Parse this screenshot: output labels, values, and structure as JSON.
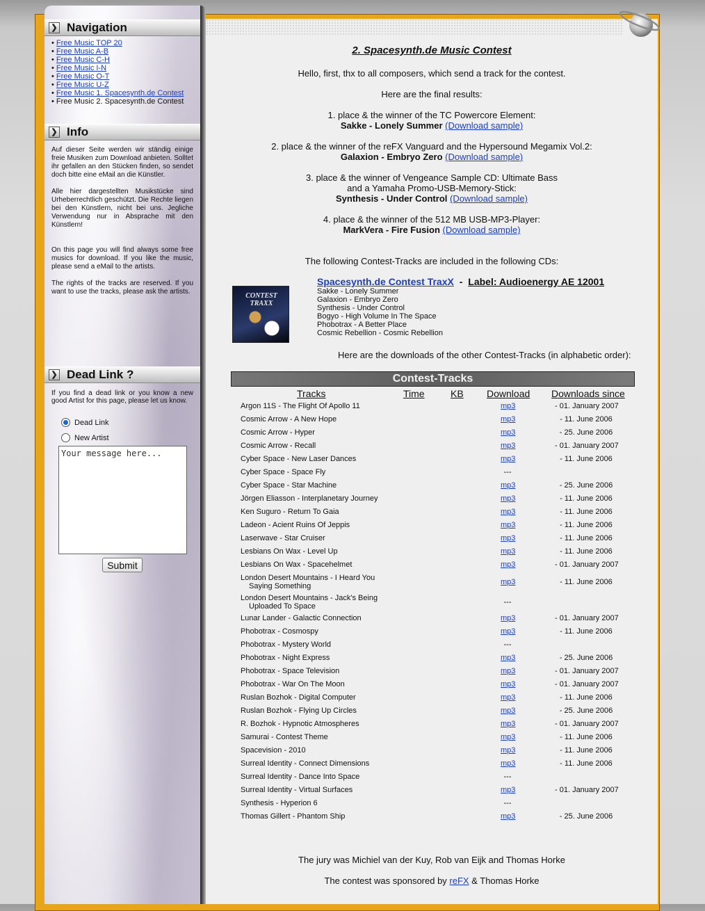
{
  "navigation": {
    "title": "Navigation",
    "items": [
      {
        "label": "Free Music TOP 20",
        "link": true
      },
      {
        "label": "Free Music A-B",
        "link": true
      },
      {
        "label": "Free Music C-H",
        "link": true
      },
      {
        "label": "Free Music I-N",
        "link": true
      },
      {
        "label": "Free Music O-T",
        "link": true
      },
      {
        "label": "Free Music U-Z",
        "link": true
      },
      {
        "label": "Free Music 1. Spacesynth.de Contest",
        "link": true
      },
      {
        "label": "Free Music 2. Spacesynth.de Contest",
        "link": false
      }
    ]
  },
  "info": {
    "title": "Info",
    "p1": "Auf dieser Seite werden wir ständig einige freie Musiken zum Download anbieten. Solltet ihr gefallen an den Stücken finden, so sendet doch bitte eine eMail an die Künstler.",
    "p2": "Alle hier dargestellten Musikstücke sind Urheberrechtlich geschützt. Die Rechte liegen bei den Künstlern, nicht bei uns. Jegliche Verwendung nur in Absprache mit den Künstlern!",
    "p3": "On this page you will find always some free musics for download. If you like the music, please send a eMail to the artists.",
    "p4": "The rights of the tracks are reserved. If you want to use the tracks, please ask the artists."
  },
  "dead_link": {
    "title": "Dead Link ?",
    "text": "If you find a dead link or you know a new good Artist for this page, please let us know.",
    "option_dead": "Dead Link",
    "option_artist": "New Artist",
    "selected": "Dead Link",
    "message_placeholder": "Your message here...",
    "submit_label": "Submit"
  },
  "content": {
    "title": "2. Spacesynth.de Music Contest",
    "intro": "Hello, first, thx to all composers, which send a track for the contest.",
    "results_intro": "Here are the final results:",
    "download_sample": "(Download sample)",
    "winners": [
      {
        "line1": "1. place & the winner of the TC Powercore Element:",
        "line2": "",
        "artist": "Sakke",
        "track": "Lonely Summer"
      },
      {
        "line1": "2. place & the winner of the reFX Vanguard and the Hypersound Megamix Vol.2:",
        "line2": "",
        "artist": "Galaxion",
        "track": "Embryo Zero"
      },
      {
        "line1": "3. place & the winner of Vengeance Sample CD: Ultimate Bass",
        "line2": "and a Yamaha Promo-USB-Memory-Stick:",
        "artist": "Synthesis",
        "track": "Under Control"
      },
      {
        "line1": "4. place & the winner of the 512 MB USB-MP3-Player:",
        "line2": "",
        "artist": "MarkVera",
        "track": "Fire Fusion"
      }
    ],
    "cd_intro": "The following Contest-Tracks are included in the following CDs:",
    "cd": {
      "cover_text": "CONTEST TRAXX",
      "title": "Spacesynth.de Contest TraxX",
      "separator": "-",
      "label": "Label: Audioenergy AE 12001",
      "tracks": [
        "Sakke - Lonely Summer",
        "Galaxion - Embryo Zero",
        "Synthesis - Under Control",
        "Bogyo - High Volume In The Space",
        "Phobotrax - A Better Place",
        "Cosmic Rebellion - Cosmic Rebellion"
      ]
    },
    "downloads_note": "Here are the downloads of the other Contest-Tracks (in alphabetic order):",
    "table": {
      "title": "Contest-Tracks",
      "columns": [
        "Tracks",
        "Time",
        "KB",
        "Download",
        "Downloads since"
      ],
      "rows": [
        {
          "track": "Argon 11S - The Flight Of Apollo 11",
          "download": "mp3",
          "since": "- 01. January 2007"
        },
        {
          "track": "Cosmic Arrow - A New Hope",
          "download": "mp3",
          "since": "- 11. June 2006"
        },
        {
          "track": "Cosmic Arrow - Hyper",
          "download": "mp3",
          "since": "- 25. June 2006"
        },
        {
          "track": "Cosmic Arrow - Recall",
          "download": "mp3",
          "since": "- 01. January 2007"
        },
        {
          "track": "Cyber Space - New Laser Dances",
          "download": "mp3",
          "since": "- 11. June 2006"
        },
        {
          "track": "Cyber Space - Space Fly",
          "download": "---",
          "since": ""
        },
        {
          "track": "Cyber Space - Star Machine",
          "download": "mp3",
          "since": "- 25. June 2006"
        },
        {
          "track": "Jörgen Eliasson - Interplanetary Journey",
          "download": "mp3",
          "since": "- 11. June 2006"
        },
        {
          "track": "Ken Suguro - Return To Gaia",
          "download": "mp3",
          "since": "- 11. June 2006"
        },
        {
          "track": "Ladeon - Acient Ruins Of Jeppis",
          "download": "mp3",
          "since": "- 11. June 2006"
        },
        {
          "track": "Laserwave - Star Cruiser",
          "download": "mp3",
          "since": "- 11. June 2006"
        },
        {
          "track": "Lesbians On Wax - Level Up",
          "download": "mp3",
          "since": "- 11. June 2006"
        },
        {
          "track": "Lesbians On Wax - Spacehelmet",
          "download": "mp3",
          "since": "- 01. January 2007"
        },
        {
          "track": "London Desert Mountains - I Heard You Saying Something",
          "download": "mp3",
          "since": "- 11. June 2006"
        },
        {
          "track": "London Desert Mountains - Jack's Being Uploaded To Space",
          "download": "---",
          "since": ""
        },
        {
          "track": "Lunar Lander - Galactic Connection",
          "download": "mp3",
          "since": "- 01. January 2007"
        },
        {
          "track": "Phobotrax - Cosmospy",
          "download": "mp3",
          "since": "- 11. June 2006"
        },
        {
          "track": "Phobotrax - Mystery World",
          "download": "---",
          "since": ""
        },
        {
          "track": "Phobotrax - Night Express",
          "download": "mp3",
          "since": "- 25. June 2006"
        },
        {
          "track": "Phobotrax - Space Television",
          "download": "mp3",
          "since": "- 01. January 2007"
        },
        {
          "track": "Phobotrax - War On The Moon",
          "download": "mp3",
          "since": "- 01. January 2007"
        },
        {
          "track": "Ruslan Bozhok - Digital Computer",
          "download": "mp3",
          "since": "- 11. June 2006"
        },
        {
          "track": "Ruslan Bozhok - Flying Up Circles",
          "download": "mp3",
          "since": "- 25. June 2006"
        },
        {
          "track": "R. Bozhok - Hypnotic Atmospheres",
          "download": "mp3",
          "since": "- 01. January 2007"
        },
        {
          "track": "Samurai - Contest Theme",
          "download": "mp3",
          "since": "- 11. June 2006"
        },
        {
          "track": "Spacevision - 2010",
          "download": "mp3",
          "since": "- 11. June 2006"
        },
        {
          "track": "Surreal Identity - Connect Dimensions",
          "download": "mp3",
          "since": "- 11. June 2006"
        },
        {
          "track": "Surreal Identity - Dance Into Space",
          "download": "---",
          "since": ""
        },
        {
          "track": "Surreal Identity - Virtual Surfaces",
          "download": "mp3",
          "since": "- 01. January 2007"
        },
        {
          "track": "Synthesis - Hyperion 6",
          "download": "---",
          "since": ""
        },
        {
          "track": "Thomas Gillert - Phantom Ship",
          "download": "mp3",
          "since": "- 25. June 2006"
        }
      ]
    },
    "jury": "The jury was Michiel van der Kuy, Rob van Eijk and Thomas Horke",
    "sponsor_prefix": "The contest was sponsored by ",
    "sponsor_link": "reFX",
    "sponsor_suffix": " & Thomas Horke"
  },
  "icons": {
    "section_arrow": "chevron-right-icon",
    "planet": "saturn-planet-icon"
  },
  "colors": {
    "frame": "#e9a51a",
    "link": "#1d3fbf",
    "content_bg": "#efefef"
  }
}
